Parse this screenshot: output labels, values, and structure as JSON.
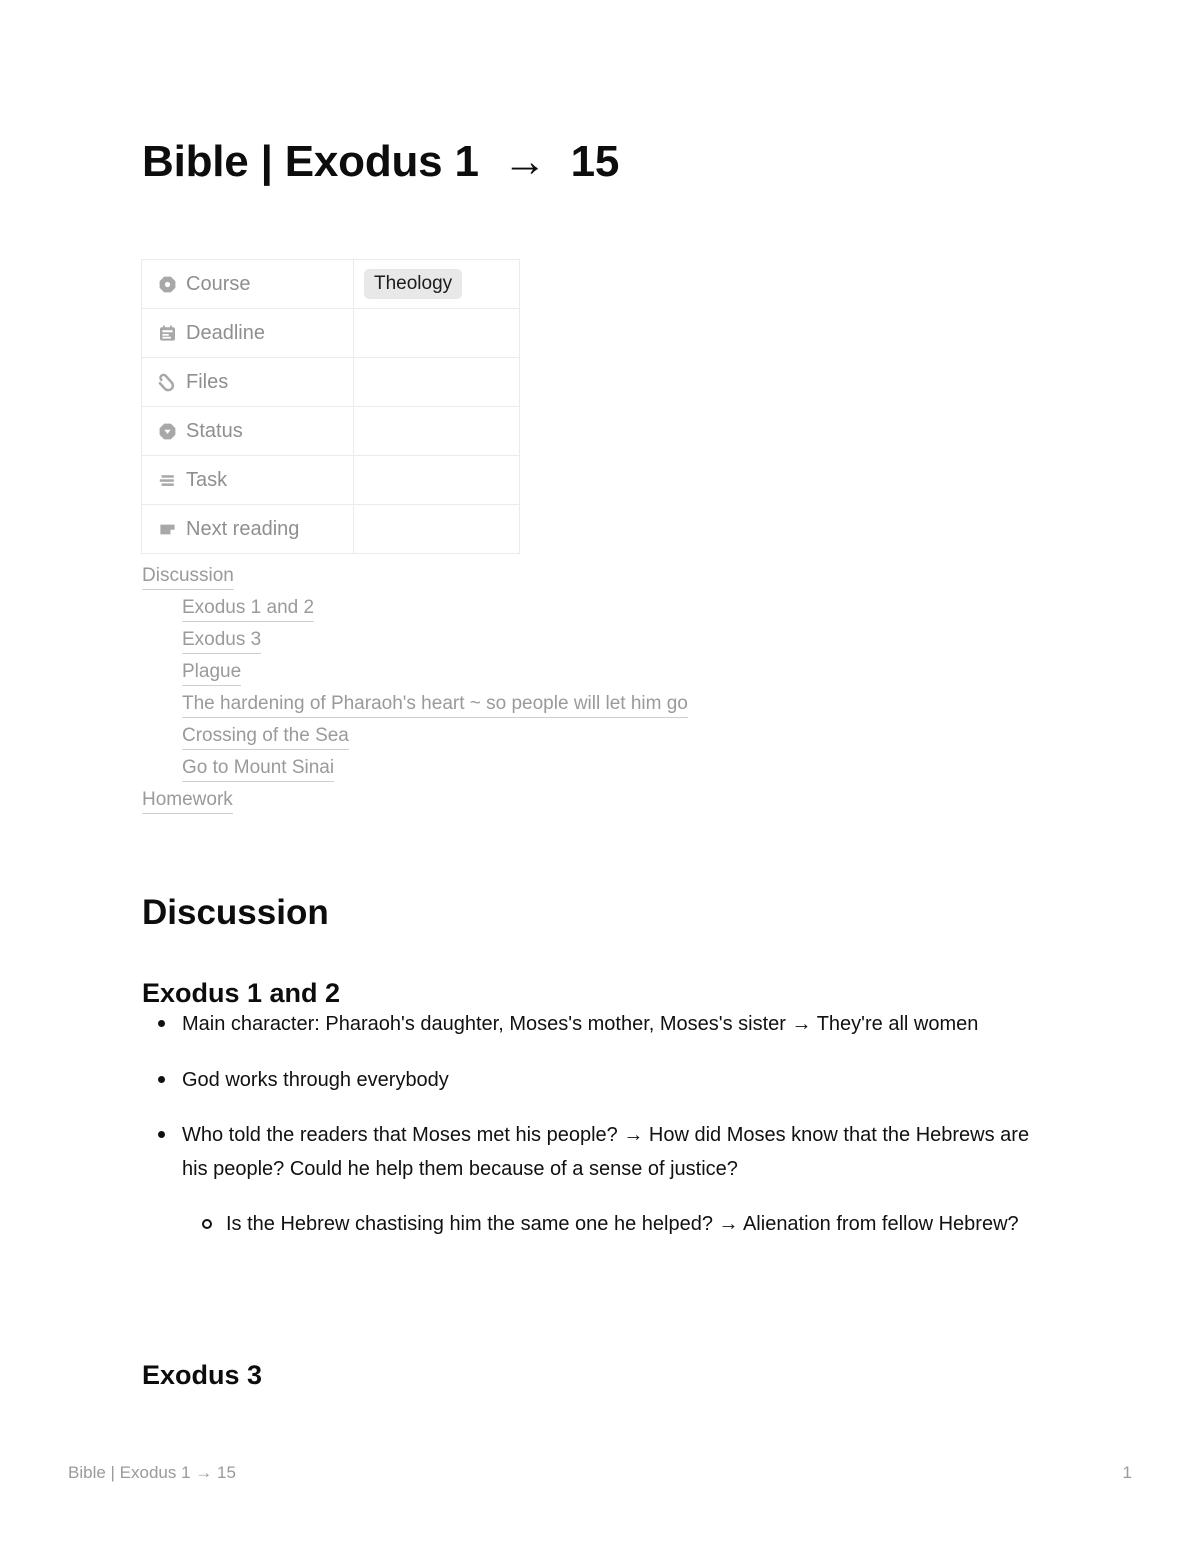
{
  "document": {
    "title": "Bible | Exodus 1  →  15"
  },
  "properties": {
    "rows": [
      {
        "icon": "course-icon",
        "label": "Course",
        "value": "Theology",
        "value_type": "tag"
      },
      {
        "icon": "calendar-icon",
        "label": "Deadline",
        "value": "",
        "value_type": "empty"
      },
      {
        "icon": "paperclip-icon",
        "label": "Files",
        "value": "",
        "value_type": "empty"
      },
      {
        "icon": "status-icon",
        "label": "Status",
        "value": "",
        "value_type": "empty"
      },
      {
        "icon": "task-list-icon",
        "label": "Task",
        "value": "",
        "value_type": "empty"
      },
      {
        "icon": "next-reading-icon",
        "label": "Next reading",
        "value": "",
        "value_type": "empty"
      }
    ]
  },
  "table_of_contents": {
    "items": [
      {
        "label": "Discussion",
        "level": 1
      },
      {
        "label": "Exodus 1 and 2",
        "level": 2
      },
      {
        "label": "Exodus 3",
        "level": 2
      },
      {
        "label": "Plague",
        "level": 2
      },
      {
        "label": "The hardening of Pharaoh's heart ~ so people will let him go",
        "level": 2
      },
      {
        "label": "Crossing of the Sea",
        "level": 2
      },
      {
        "label": "Go to Mount Sinai",
        "level": 2
      },
      {
        "label": "Homework",
        "level": 1
      }
    ]
  },
  "content": {
    "section_heading": "Discussion",
    "subsection_1": "Exodus 1 and 2",
    "subsection_2": "Exodus 3",
    "bullets": [
      {
        "text": "Main character: Pharaoh's daughter, Moses's mother, Moses's sister → They're all women",
        "level": 1
      },
      {
        "text": "God works through everybody",
        "level": 1
      },
      {
        "text": "Who told the readers that Moses met his people? → How did Moses know that the Hebrews are his people? Could he help them because of a sense of justice?",
        "level": 1
      },
      {
        "text": "Is the Hebrew chastising him the same one he helped? → Alienation from fellow Hebrew?",
        "level": 2
      }
    ]
  },
  "footer": {
    "left": "Bible | Exodus 1 → 15",
    "page_number": "1"
  },
  "colors": {
    "text": "#111111",
    "muted": "#9a9a9a",
    "icon": "#a0a0a0",
    "border": "#ebebeb",
    "tag_background": "#e8e8e8"
  }
}
